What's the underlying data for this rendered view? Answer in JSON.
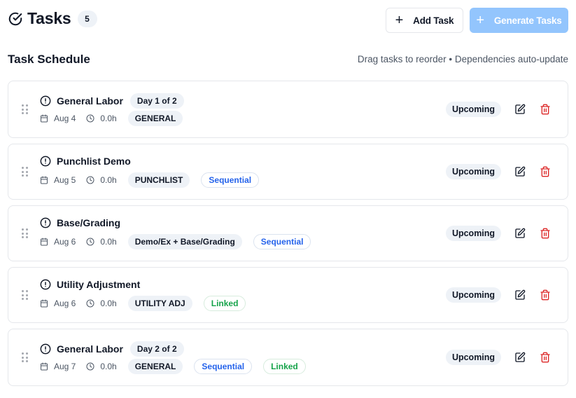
{
  "header": {
    "title": "Tasks",
    "count": "5",
    "add_button": "Add Task",
    "generate_button": "Generate Tasks"
  },
  "section": {
    "title": "Task Schedule",
    "hint": "Drag tasks to reorder • Dependencies auto-update"
  },
  "tasks": [
    {
      "name": "General Labor",
      "day": "Day 1 of 2",
      "date": "Aug 4",
      "hours": "0.0h",
      "code": "GENERAL",
      "tags": [],
      "status": "Upcoming"
    },
    {
      "name": "Punchlist Demo",
      "day": "",
      "date": "Aug 5",
      "hours": "0.0h",
      "code": "PUNCHLIST",
      "tags": [
        "Sequential"
      ],
      "status": "Upcoming"
    },
    {
      "name": "Base/Grading",
      "day": "",
      "date": "Aug 6",
      "hours": "0.0h",
      "code": "Demo/Ex + Base/Grading",
      "tags": [
        "Sequential"
      ],
      "status": "Upcoming"
    },
    {
      "name": "Utility Adjustment",
      "day": "",
      "date": "Aug 6",
      "hours": "0.0h",
      "code": "UTILITY ADJ",
      "tags": [
        "Linked"
      ],
      "status": "Upcoming"
    },
    {
      "name": "General Labor",
      "day": "Day 2 of 2",
      "date": "Aug 7",
      "hours": "0.0h",
      "code": "GENERAL",
      "tags": [
        "Sequential",
        "Linked"
      ],
      "status": "Upcoming"
    }
  ],
  "colors": {
    "primary_disabled": "#93c5fd",
    "sequential": "#2563eb",
    "linked": "#16a34a",
    "delete": "#dc2626",
    "badge_bg": "#eef2f7"
  },
  "icons": {
    "title": "check-circle-icon",
    "add": "plus-icon",
    "generate": "plus-icon",
    "drag": "grip-vertical-icon",
    "task": "alert-circle-icon",
    "date": "calendar-icon",
    "hours": "clock-icon",
    "edit": "edit-icon",
    "delete": "trash-icon"
  }
}
